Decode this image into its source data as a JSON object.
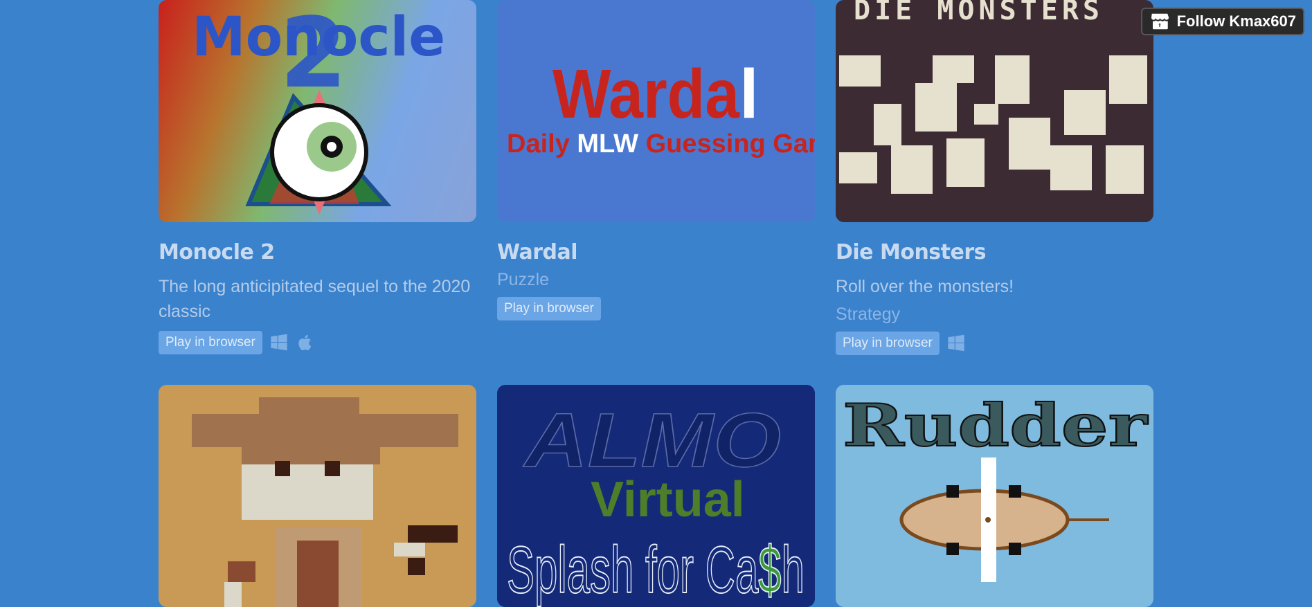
{
  "follow_button": {
    "label": "Follow Kmax607",
    "icon": "itchio-icon"
  },
  "games": [
    {
      "title": "Monocle 2",
      "description": "The long anticipitated sequel to the 2020 classic",
      "genre": "",
      "play_label": "Play in browser",
      "platforms": [
        "windows-icon",
        "apple-icon"
      ],
      "cover_text": [
        "Monocle",
        "2"
      ]
    },
    {
      "title": "Wardal",
      "description": "",
      "genre": "Puzzle",
      "play_label": "Play in browser",
      "platforms": [],
      "cover_text": [
        "Warda",
        "l",
        "Daily ",
        "MLW",
        " Guessing Game"
      ]
    },
    {
      "title": "Die Monsters",
      "description": "Roll over the monsters!",
      "genre": "Strategy",
      "play_label": "Play in browser",
      "platforms": [
        "windows-icon"
      ],
      "cover_text": [
        "DIE MONSTERS"
      ]
    },
    {
      "title": "",
      "cover_text": []
    },
    {
      "title": "",
      "cover_text": [
        "ALMO",
        "Virtual",
        "Splash for Ca",
        "$",
        "h"
      ]
    },
    {
      "title": "",
      "cover_text": [
        "Rudder"
      ]
    }
  ],
  "colors": {
    "background": "#3b82cd",
    "button": "#6aa5e6"
  }
}
